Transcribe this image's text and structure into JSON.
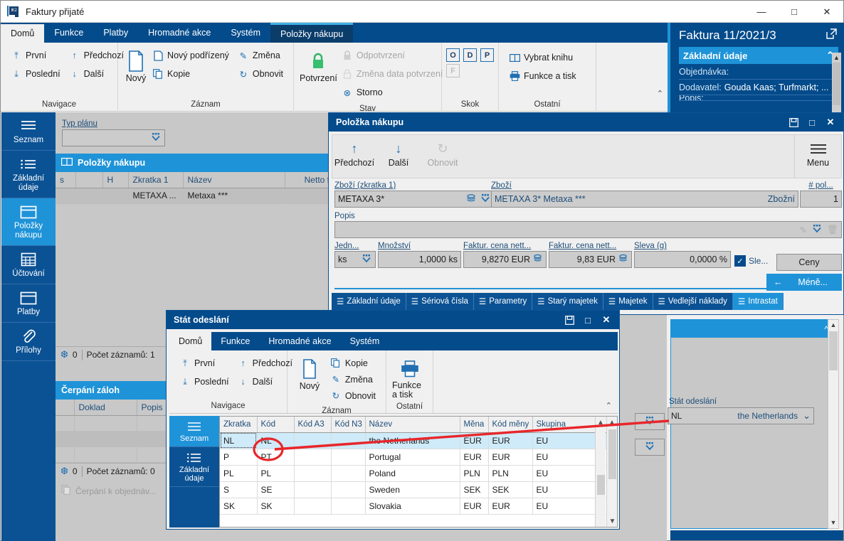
{
  "main_window": {
    "title": "Faktury přijaté",
    "app_icon": "ik2-app-icon",
    "controls": {
      "minimize": "—",
      "maximize": "□",
      "close": "✕"
    }
  },
  "ribbon": {
    "tabs": [
      {
        "label": "Domů",
        "state": "active"
      },
      {
        "label": "Funkce",
        "state": "normal"
      },
      {
        "label": "Platby",
        "state": "normal"
      },
      {
        "label": "Hromadné akce",
        "state": "normal"
      },
      {
        "label": "Systém",
        "state": "normal"
      },
      {
        "label": "Položky nákupu",
        "state": "context"
      }
    ],
    "groups": [
      {
        "label": "Navigace",
        "items_col1": [
          {
            "label": "První",
            "icon": "arrow-up-to-line-icon",
            "glyph": "⤒",
            "disabled": false
          },
          {
            "label": "Poslední",
            "icon": "arrow-down-to-line-icon",
            "glyph": "⤓",
            "disabled": false
          }
        ],
        "items_col2": [
          {
            "label": "Předchozí",
            "icon": "arrow-up-icon",
            "glyph": "↑",
            "disabled": false
          },
          {
            "label": "Další",
            "icon": "arrow-down-icon",
            "glyph": "↓",
            "disabled": false
          }
        ]
      },
      {
        "label": "Záznam",
        "big": {
          "label": "Nový",
          "icon": "new-document-icon"
        },
        "items_col1": [
          {
            "label": "Nový podřízený",
            "icon": "new-child-document-icon",
            "glyph": "὜B",
            "disabled": false
          },
          {
            "label": "Kopie",
            "icon": "copy-icon",
            "glyph": "❐",
            "disabled": false
          }
        ],
        "items_col2": [
          {
            "label": "Změna",
            "icon": "pencil-icon",
            "glyph": "✎",
            "disabled": false
          },
          {
            "label": "Obnovit",
            "icon": "refresh-icon",
            "glyph": "↻",
            "disabled": false
          }
        ]
      },
      {
        "label": "Stav",
        "big": {
          "label": "Potvrzení",
          "icon": "green-lock-icon"
        },
        "items_col1": [
          {
            "label": "Odpotvrzení",
            "icon": "lock-icon",
            "glyph": "ὑ2",
            "disabled": true
          },
          {
            "label": "Změna data potvrzení",
            "icon": "lock-icon",
            "glyph": "ὑ2",
            "disabled": true
          },
          {
            "label": "Storno",
            "icon": "circle-x-icon",
            "glyph": "⊗",
            "disabled": false
          }
        ]
      },
      {
        "label": "Skok",
        "jump_buttons": [
          {
            "label": "O",
            "disabled": false
          },
          {
            "label": "D",
            "disabled": false
          },
          {
            "label": "P",
            "disabled": false
          },
          {
            "label": "F",
            "disabled": true
          }
        ]
      },
      {
        "label": "Ostatní",
        "items_col1": [
          {
            "label": "Vybrat knihu",
            "icon": "book-icon",
            "glyph": "Ὅ6",
            "disabled": false
          },
          {
            "label": "Funkce a tisk",
            "icon": "printer-icon",
            "glyph": "⎙",
            "disabled": false
          }
        ]
      }
    ],
    "collapse_glyph": "⌃"
  },
  "sidebar": {
    "items": [
      {
        "label": "Seznam",
        "icon": "list-lines-icon",
        "active": false
      },
      {
        "label": "Základní údaje",
        "icon": "bulleted-list-icon",
        "active": false
      },
      {
        "label": "Položky nákupu",
        "icon": "window-box-icon",
        "active": true
      },
      {
        "label": "Účtování",
        "icon": "calculator-grid-icon",
        "active": false
      },
      {
        "label": "Platby",
        "icon": "window-box-icon",
        "active": false
      },
      {
        "label": "Přílohy",
        "icon": "paperclip-icon",
        "active": false
      }
    ]
  },
  "content": {
    "typ_planu": {
      "label": "Typ plánu",
      "value": "",
      "caret": "⌄"
    },
    "polozky_panel": {
      "title": "Položky nákupu",
      "icon": "book-icon",
      "columns": [
        "s",
        "",
        "H",
        "Zkratka 1",
        "Název",
        "Netto f"
      ],
      "rows": [
        {
          "s": "",
          "blank": "",
          "h": "",
          "zkratka1": "METAXA ...",
          "nazev": "Metaxa ***",
          "netto": ""
        }
      ],
      "status": {
        "count_icon": "snowflake-icon",
        "count_value": "0",
        "text": "Počet záznamů: 1"
      }
    },
    "cerpani_panel": {
      "title": "Čerpání záloh",
      "columns": [
        "",
        "Doklad",
        "Popis"
      ],
      "rows": [],
      "status": {
        "count_icon": "snowflake-icon",
        "count_value": "0",
        "text": "Počet záznamů: 0"
      },
      "footer_action": {
        "label": "Čerpání k objednáv...",
        "icon": "document-copy-icon",
        "disabled": true
      }
    }
  },
  "right_panel": {
    "title": "Faktura 11/2021/3",
    "popout_icon": "popout-icon",
    "section": {
      "label": "Základní údaje",
      "collapse_glyph": "⌃"
    },
    "rows": [
      {
        "text": "Objednávka:"
      },
      {
        "label": "Dodavatel:",
        "value": "Gouda Kaas; Turfmarkt; ..."
      },
      {
        "text": "Popis:"
      }
    ]
  },
  "dialog_polozka": {
    "title": "Položka nákupu",
    "controls": {
      "save": "὚B",
      "maximize": "□",
      "close": "✕"
    },
    "toolbar": [
      {
        "label": "Předchozí",
        "icon": "arrow-up-icon",
        "glyph": "↑",
        "disabled": false
      },
      {
        "label": "Další",
        "icon": "arrow-down-icon",
        "glyph": "↓",
        "disabled": false
      },
      {
        "label": "Obnovit",
        "icon": "refresh-icon",
        "glyph": "↻",
        "disabled": true
      }
    ],
    "menu": {
      "label": "Menu",
      "icon": "hamburger-icon"
    },
    "fields": {
      "zbozi_zkratka": {
        "label": "Zboží (zkratka 1)",
        "value": "METAXA 3*"
      },
      "zbozi": {
        "label": "Zboží",
        "value": "METAXA 3* Metaxa ***",
        "right_text": "Zbožní"
      },
      "pocet_pol": {
        "label": "# pol...",
        "value": "1"
      },
      "popis": {
        "label": "Popis",
        "value": ""
      },
      "jednotka": {
        "label": "Jedn...",
        "value": "ks"
      },
      "mnozstvi": {
        "label": "Množství",
        "value": "1,0000 ks"
      },
      "faktur_cena_1": {
        "label": "Faktur. cena nett...",
        "value": "9,8270 EUR"
      },
      "faktur_cena_2": {
        "label": "Faktur. cena nett...",
        "value": "9,83 EUR"
      },
      "sleva": {
        "label": "Sleva (g)",
        "value": "0,0000 %"
      },
      "sleva_check": {
        "label": "Sle...",
        "checked": true,
        "glyph": "✓"
      }
    },
    "buttons": {
      "ceny": "Ceny",
      "mene": "Méně...",
      "mene_arrow": "←"
    },
    "tabs": [
      {
        "label": "Základní údaje",
        "active": false
      },
      {
        "label": "Sériová čísla",
        "active": false
      },
      {
        "label": "Parametry",
        "active": false
      },
      {
        "label": "Starý majetek",
        "active": false
      },
      {
        "label": "Majetek",
        "active": false
      },
      {
        "label": "Vedlejší náklady",
        "active": false
      },
      {
        "label": "Intrastat",
        "active": true
      }
    ],
    "intrastat": {
      "stat_odeslani": {
        "label": "Stát odeslání",
        "code": "NL",
        "name": "the Netherlands",
        "caret": "⌄"
      }
    }
  },
  "dialog_stat": {
    "title": "Stát odeslání",
    "controls": {
      "save": "὚B",
      "maximize": "□",
      "close": "✕"
    },
    "tabs": [
      {
        "label": "Domů",
        "active": true
      },
      {
        "label": "Funkce",
        "active": false
      },
      {
        "label": "Hromadné akce",
        "active": false
      },
      {
        "label": "Systém",
        "active": false
      }
    ],
    "groups": [
      {
        "label": "Navigace",
        "items_col1": [
          {
            "label": "První",
            "icon": "arrow-up-to-line-icon",
            "glyph": "⤒"
          },
          {
            "label": "Poslední",
            "icon": "arrow-down-to-line-icon",
            "glyph": "⤓"
          }
        ],
        "items_col2": [
          {
            "label": "Předchozí",
            "icon": "arrow-up-icon",
            "glyph": "↑"
          },
          {
            "label": "Další",
            "icon": "arrow-down-icon",
            "glyph": "↓"
          }
        ]
      },
      {
        "label": "Záznam",
        "big": {
          "label": "Nový",
          "icon": "new-document-icon"
        },
        "items_col1": [
          {
            "label": "Kopie",
            "icon": "copy-icon",
            "glyph": "❐"
          },
          {
            "label": "Změna",
            "icon": "pencil-icon",
            "glyph": "✎"
          },
          {
            "label": "Obnovit",
            "icon": "refresh-icon",
            "glyph": "↻"
          }
        ]
      },
      {
        "label": "Ostatní",
        "big": {
          "label": "Funkce a tisk",
          "icon": "printer-icon"
        }
      }
    ],
    "collapse_glyph": "⌃",
    "sidebar": [
      {
        "label": "Seznam",
        "icon": "list-lines-icon",
        "active": true
      },
      {
        "label": "Základní údaje",
        "icon": "bulleted-list-icon",
        "active": false
      }
    ],
    "table": {
      "columns": [
        "Zkratka",
        "Kód",
        "Kód A3",
        "Kód N3",
        "Název",
        "Měna",
        "Kód měny",
        "Skupina"
      ],
      "rows": [
        {
          "zkratka": "NL",
          "kod": "NL",
          "kod_a3": "",
          "kod_n3": "",
          "nazev": "the Netherlands",
          "mena": "EUR",
          "kod_meny": "EUR",
          "skupina": "EU",
          "selected": true
        },
        {
          "zkratka": "P",
          "kod": "PT",
          "kod_a3": "",
          "kod_n3": "",
          "nazev": "Portugal",
          "mena": "EUR",
          "kod_meny": "EUR",
          "skupina": "EU",
          "selected": false
        },
        {
          "zkratka": "PL",
          "kod": "PL",
          "kod_a3": "",
          "kod_n3": "",
          "nazev": "Poland",
          "mena": "PLN",
          "kod_meny": "PLN",
          "skupina": "EU",
          "selected": false
        },
        {
          "zkratka": "S",
          "kod": "SE",
          "kod_a3": "",
          "kod_n3": "",
          "nazev": "Sweden",
          "mena": "SEK",
          "kod_meny": "SEK",
          "skupina": "EU",
          "selected": false
        },
        {
          "zkratka": "SK",
          "kod": "SK",
          "kod_a3": "",
          "kod_n3": "",
          "nazev": "Slovakia",
          "mena": "EUR",
          "kod_meny": "EUR",
          "skupina": "EU",
          "selected": false
        }
      ]
    }
  },
  "annotation": {
    "color": "#e8262a",
    "circle_label": "highlight-circle-on-nl-code",
    "line_label": "pointer-line-to-stat-odeslani-field"
  }
}
